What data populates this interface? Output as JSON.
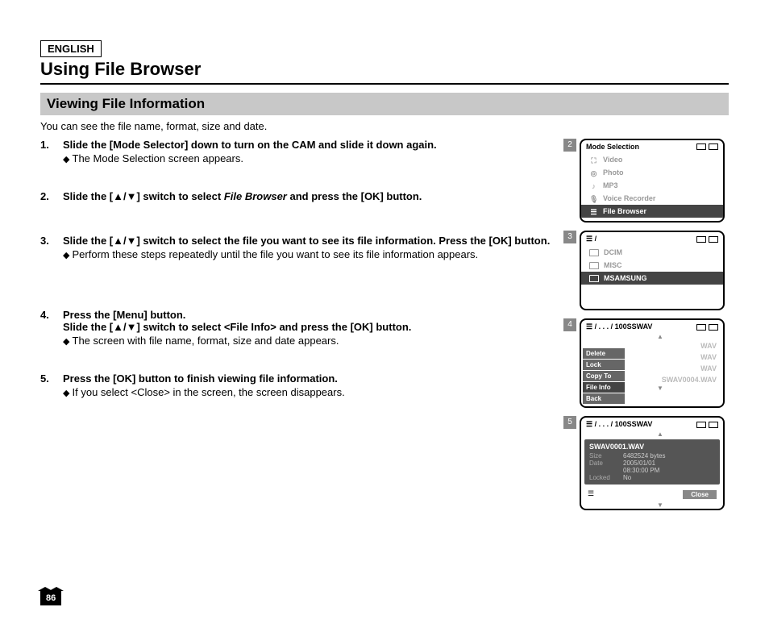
{
  "language_label": "ENGLISH",
  "page_title": "Using File Browser",
  "section_title": "Viewing File Information",
  "intro_text": "You can see the file name, format, size and date.",
  "page_number": "86",
  "steps": [
    {
      "num": "1.",
      "bold_a": "Slide the [Mode Selector] down to turn on the CAM and slide it down again.",
      "sub": "The Mode Selection screen appears."
    },
    {
      "num": "2.",
      "bold_a": "Slide the [▲/▼] switch to select ",
      "italic": "File Browser",
      "bold_b": " and press the [OK] button."
    },
    {
      "num": "3.",
      "bold_a": "Slide the [▲/▼] switch to select the file you want to see its file information. Press the [OK] button.",
      "sub": "Perform these steps repeatedly until the file you want to see its file information appears."
    },
    {
      "num": "4.",
      "bold_a": "Press the [Menu] button.",
      "bold_b": "Slide the [▲/▼] switch to select <File Info> and press the [OK] button.",
      "sub": "The screen with file name, format, size and date appears."
    },
    {
      "num": "5.",
      "bold_a": "Press the [OK] button to finish viewing file information.",
      "sub": "If you select <Close> in the screen, the screen disappears."
    }
  ],
  "screen2": {
    "badge": "2",
    "title": "Mode Selection",
    "items": [
      "Video",
      "Photo",
      "MP3",
      "Voice Recorder",
      "File Browser"
    ]
  },
  "screen3": {
    "badge": "3",
    "path": "/",
    "folders": [
      "DCIM",
      "MISC",
      "MSAMSUNG"
    ]
  },
  "screen4": {
    "badge": "4",
    "path": "/ . . . / 100SSWAV",
    "menu": [
      "Delete",
      "Lock",
      "Copy To",
      "File Info",
      "Back"
    ],
    "bg_files": [
      "",
      "WAV",
      "WAV",
      "WAV",
      "SWAV0004.WAV"
    ]
  },
  "screen5": {
    "badge": "5",
    "path": "/ . . . / 100SSWAV",
    "filename": "SWAV0001.WAV",
    "rows": [
      {
        "label": "Size",
        "value": "6482524 bytes"
      },
      {
        "label": "Date",
        "value": "2005/01/01"
      },
      {
        "label": "",
        "value": "08:30:00 PM"
      },
      {
        "label": "Locked",
        "value": "No"
      }
    ],
    "close": "Close"
  }
}
